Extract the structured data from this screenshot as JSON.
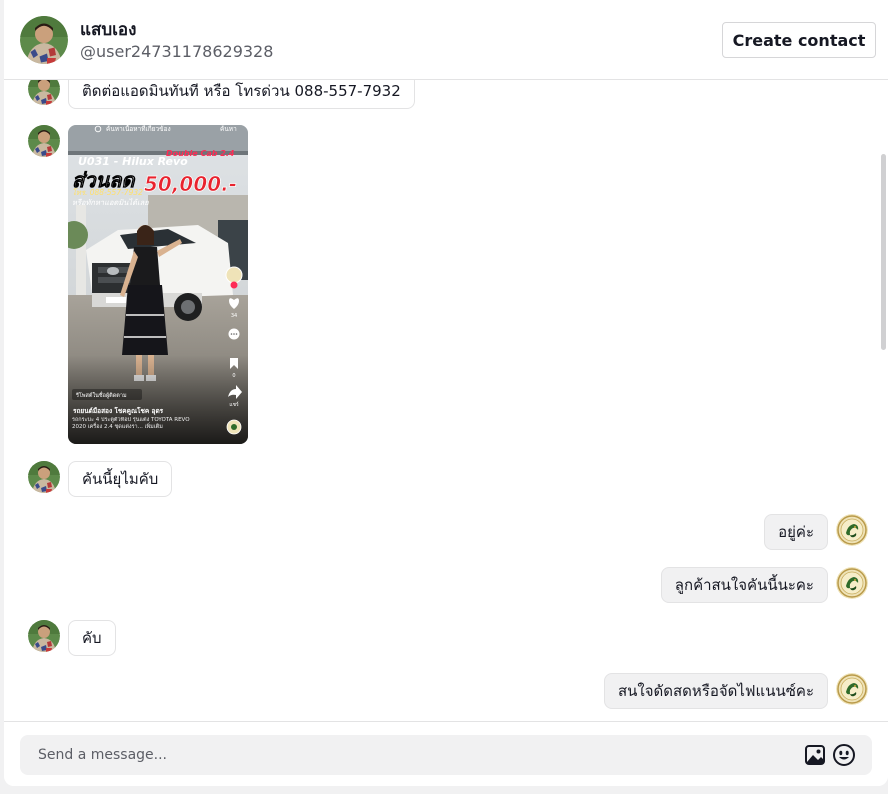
{
  "header": {
    "name": "แสบเอง",
    "handle": "@user24731178629328",
    "create_contact_label": "Create contact"
  },
  "messages": [
    {
      "from": "contact",
      "text": "ติดต่อแอดมินทันที หรือ โทรด่วน 088-557-7932"
    },
    {
      "from": "contact",
      "type": "video",
      "overlay": {
        "search": "ค้นหาเนื้อหาที่เกี่ยวข้อง",
        "search_btn": "ค้นหา",
        "code": "U031 - Hilux Revo",
        "code_highlight": "Double Cab 2.4",
        "discount_label": "ส่วนลด",
        "discount_value": "50,000.-",
        "phone": "โทร. 088-557-7932",
        "phone_sub": "หรือทักหาแอดมินได้เลย",
        "repost": "รีโพสต์ในชื่อผู้ติดตาม",
        "account": "รถยนต์มือสอง โชคคูณโชค อุดร",
        "caption": "รถกระบะ 4 ประตูตัวท็อป รุ่นแต่ง TOYOTA REVO 2020 เครื่อง 2.4 ชุดแต่งรา... เพิ่มเติม",
        "likes": "34",
        "saves": "0",
        "shares": "แชร์"
      }
    },
    {
      "from": "contact",
      "text": "คันนี้ยุไมคับ"
    },
    {
      "from": "me",
      "text": "อยู่ค่ะ"
    },
    {
      "from": "me",
      "text": "ลูกค้าสนใจคันนี้นะคะ"
    },
    {
      "from": "contact",
      "text": "คับ"
    },
    {
      "from": "me",
      "text": "สนใจดัดสดหรือจัดไฟแนนซ์คะ"
    }
  ],
  "composer": {
    "placeholder": "Send a message...",
    "icons": [
      "image-icon",
      "emoji-icon"
    ]
  },
  "colors": {
    "accent_red": "#fe2c55",
    "incoming_bubble": "#ffffff",
    "outgoing_bubble": "#f1f1f2",
    "border": "#e3e3e4"
  }
}
